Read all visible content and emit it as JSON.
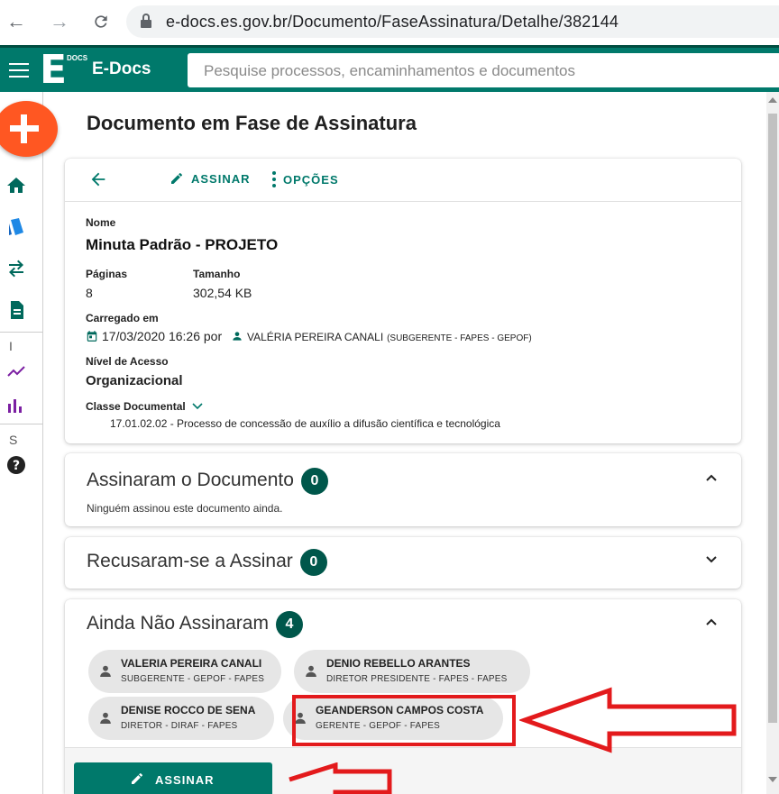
{
  "browser": {
    "url": "e-docs.es.gov.br/Documento/FaseAssinatura/Detalhe/382144"
  },
  "app": {
    "logo_letter": "E",
    "logo_sub": "DOCS",
    "title": "E-Docs",
    "search_placeholder": "Pesquise processos, encaminhamentos e documentos"
  },
  "rail": {
    "letter_1": "I",
    "letter_2": "S"
  },
  "page": {
    "title": "Documento em Fase de Assinatura"
  },
  "toolbar": {
    "sign_label": "ASSINAR",
    "options_label": "OPÇÕES"
  },
  "document": {
    "name_label": "Nome",
    "name": "Minuta Padrão - PROJETO",
    "pages_label": "Páginas",
    "pages": "8",
    "size_label": "Tamanho",
    "size": "302,54 KB",
    "uploaded_label": "Carregado em",
    "uploaded_date": "17/03/2020 16:26 por",
    "uploaded_by": "VALÉRIA PEREIRA CANALI",
    "uploaded_by_role": "(SUBGERENTE - FAPES - GEPOF)",
    "access_label": "Nível de Acesso",
    "access": "Organizacional",
    "class_label": "Classe Documental",
    "class_value": "17.01.02.02 - Processo de concessão de auxílio a difusão científica e tecnológica"
  },
  "signed": {
    "title": "Assinaram o Documento",
    "count": "0",
    "note": "Ninguém assinou este documento ainda."
  },
  "refused": {
    "title": "Recusaram-se a Assinar",
    "count": "0"
  },
  "pending": {
    "title": "Ainda Não Assinaram",
    "count": "4",
    "people": [
      {
        "name": "VALERIA PEREIRA CANALI",
        "role": "SUBGERENTE - GEPOF - FAPES"
      },
      {
        "name": "DENIO REBELLO ARANTES",
        "role": "DIRETOR PRESIDENTE - FAPES - FAPES"
      },
      {
        "name": "DENISE ROCCO DE SENA",
        "role": "DIRETOR - DIRAF - FAPES"
      },
      {
        "name": "GEANDERSON CAMPOS COSTA",
        "role": "GERENTE - GEPOF - FAPES"
      }
    ]
  },
  "footer": {
    "sign_button": "ASSINAR"
  },
  "colors": {
    "primary": "#00796b",
    "primary_dark": "#004d40",
    "badge": "#00574b",
    "fab": "#ff5722",
    "annotation_red": "#e31a1c"
  }
}
